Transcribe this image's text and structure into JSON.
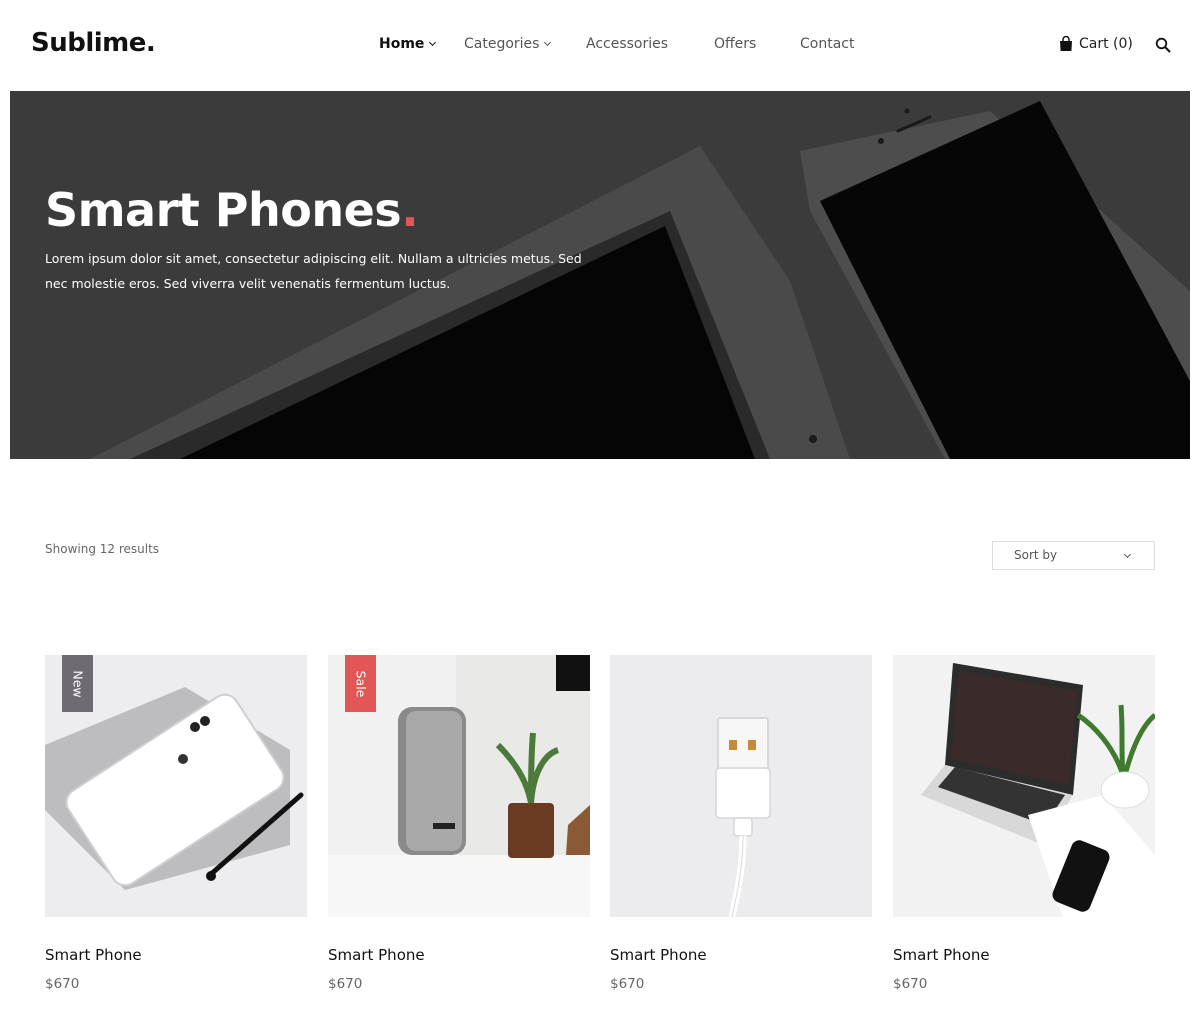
{
  "brand": {
    "logo": "Sublime."
  },
  "nav": {
    "items": [
      {
        "label": "Home",
        "has_dropdown": true,
        "active": true
      },
      {
        "label": "Categories",
        "has_dropdown": true,
        "active": false
      },
      {
        "label": "Accessories",
        "has_dropdown": false,
        "active": false
      },
      {
        "label": "Offers",
        "has_dropdown": false,
        "active": false
      },
      {
        "label": "Contact",
        "has_dropdown": false,
        "active": false
      }
    ],
    "cart_label": "Cart (0)",
    "cart_icon": "shopping-bag-icon",
    "search_icon": "search-icon"
  },
  "hero": {
    "title": "Smart Phones",
    "title_dot": ".",
    "text": "Lorem ipsum dolor sit amet, consectetur adipiscing elit. Nullam a ultricies metus. Sed nec molestie eros. Sed viverra velit venenatis fermentum luctus."
  },
  "toolbar": {
    "results_text": "Showing 12 results",
    "sort_label": "Sort by"
  },
  "products": [
    {
      "name": "Smart Phone",
      "price": "$670",
      "badge": "New",
      "image": "white phone on grey notebook with pen"
    },
    {
      "name": "Smart Phone",
      "price": "$670",
      "badge": "Sale",
      "image": "speaker and potted plant"
    },
    {
      "name": "Smart Phone",
      "price": "$670",
      "badge": "",
      "image": "white USB cable"
    },
    {
      "name": "Smart Phone",
      "price": "$670",
      "badge": "",
      "image": "laptop, phone and plant on desk"
    }
  ],
  "colors": {
    "accent": "#e25656",
    "badge_new": "#6e6b72",
    "badge_sale": "#e25656",
    "text": "#111111",
    "muted": "#666666"
  }
}
